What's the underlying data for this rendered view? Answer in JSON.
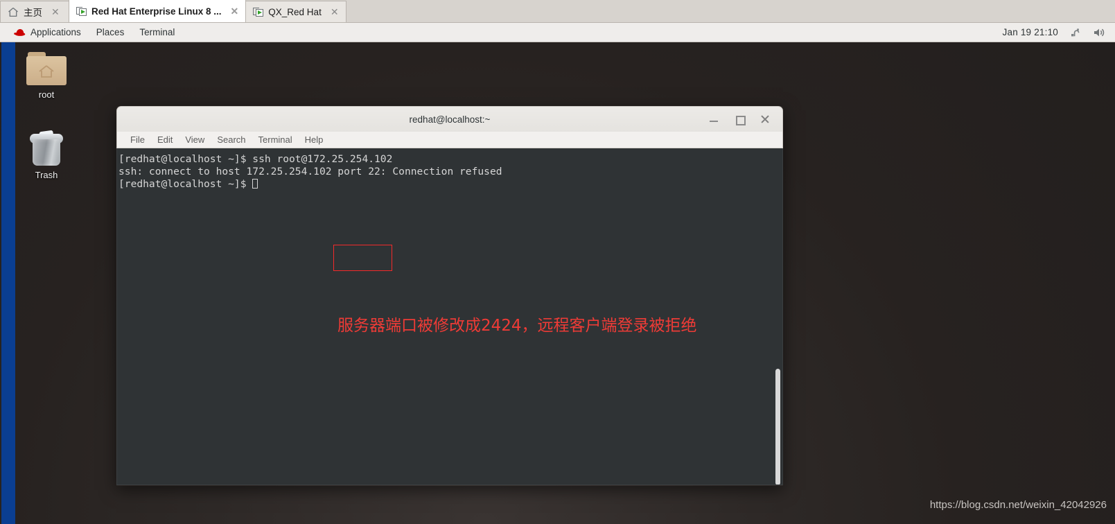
{
  "vmware_tabs": [
    {
      "label": "主页",
      "icon": "home-icon",
      "active": false,
      "closable": true
    },
    {
      "label": "Red Hat Enterprise Linux 8 ...",
      "icon": "vm-powered-on-icon",
      "active": true,
      "closable": true
    },
    {
      "label": "QX_Red Hat",
      "icon": "vm-powered-on-icon",
      "active": false,
      "closable": true
    }
  ],
  "gnome_panel": {
    "menus": [
      {
        "label": "Applications",
        "icon": "redhat-logo-icon"
      },
      {
        "label": "Places",
        "icon": ""
      },
      {
        "label": "Terminal",
        "icon": ""
      }
    ],
    "clock": "Jan 19  21:10",
    "tray": [
      {
        "name": "accessibility-icon"
      },
      {
        "name": "volume-icon"
      }
    ]
  },
  "desktop": {
    "icons": [
      {
        "label": "root",
        "icon": "home-folder-icon"
      },
      {
        "label": "Trash",
        "icon": "trash-icon"
      }
    ],
    "watermark": "https://blog.csdn.net/weixin_42042926"
  },
  "terminal": {
    "title": "redhat@localhost:~",
    "menubar": [
      "File",
      "Edit",
      "View",
      "Search",
      "Terminal",
      "Help"
    ],
    "window_buttons": {
      "minimize": "minimize-button",
      "maximize": "maximize-button",
      "close": "close-button"
    },
    "lines": [
      "[redhat@localhost ~]$ ssh root@172.25.254.102",
      "ssh: connect to host 172.25.254.102 port 22: Connection refused"
    ],
    "prompt": "[redhat@localhost ~]$ ",
    "annotation": "服务器端口被修改成2424，远程客户端登录被拒绝",
    "colors": {
      "background": "#2f3335",
      "foreground": "#d6d6d6",
      "annotation": "#ef3b36",
      "highlight_box": "#f42a2a"
    }
  }
}
